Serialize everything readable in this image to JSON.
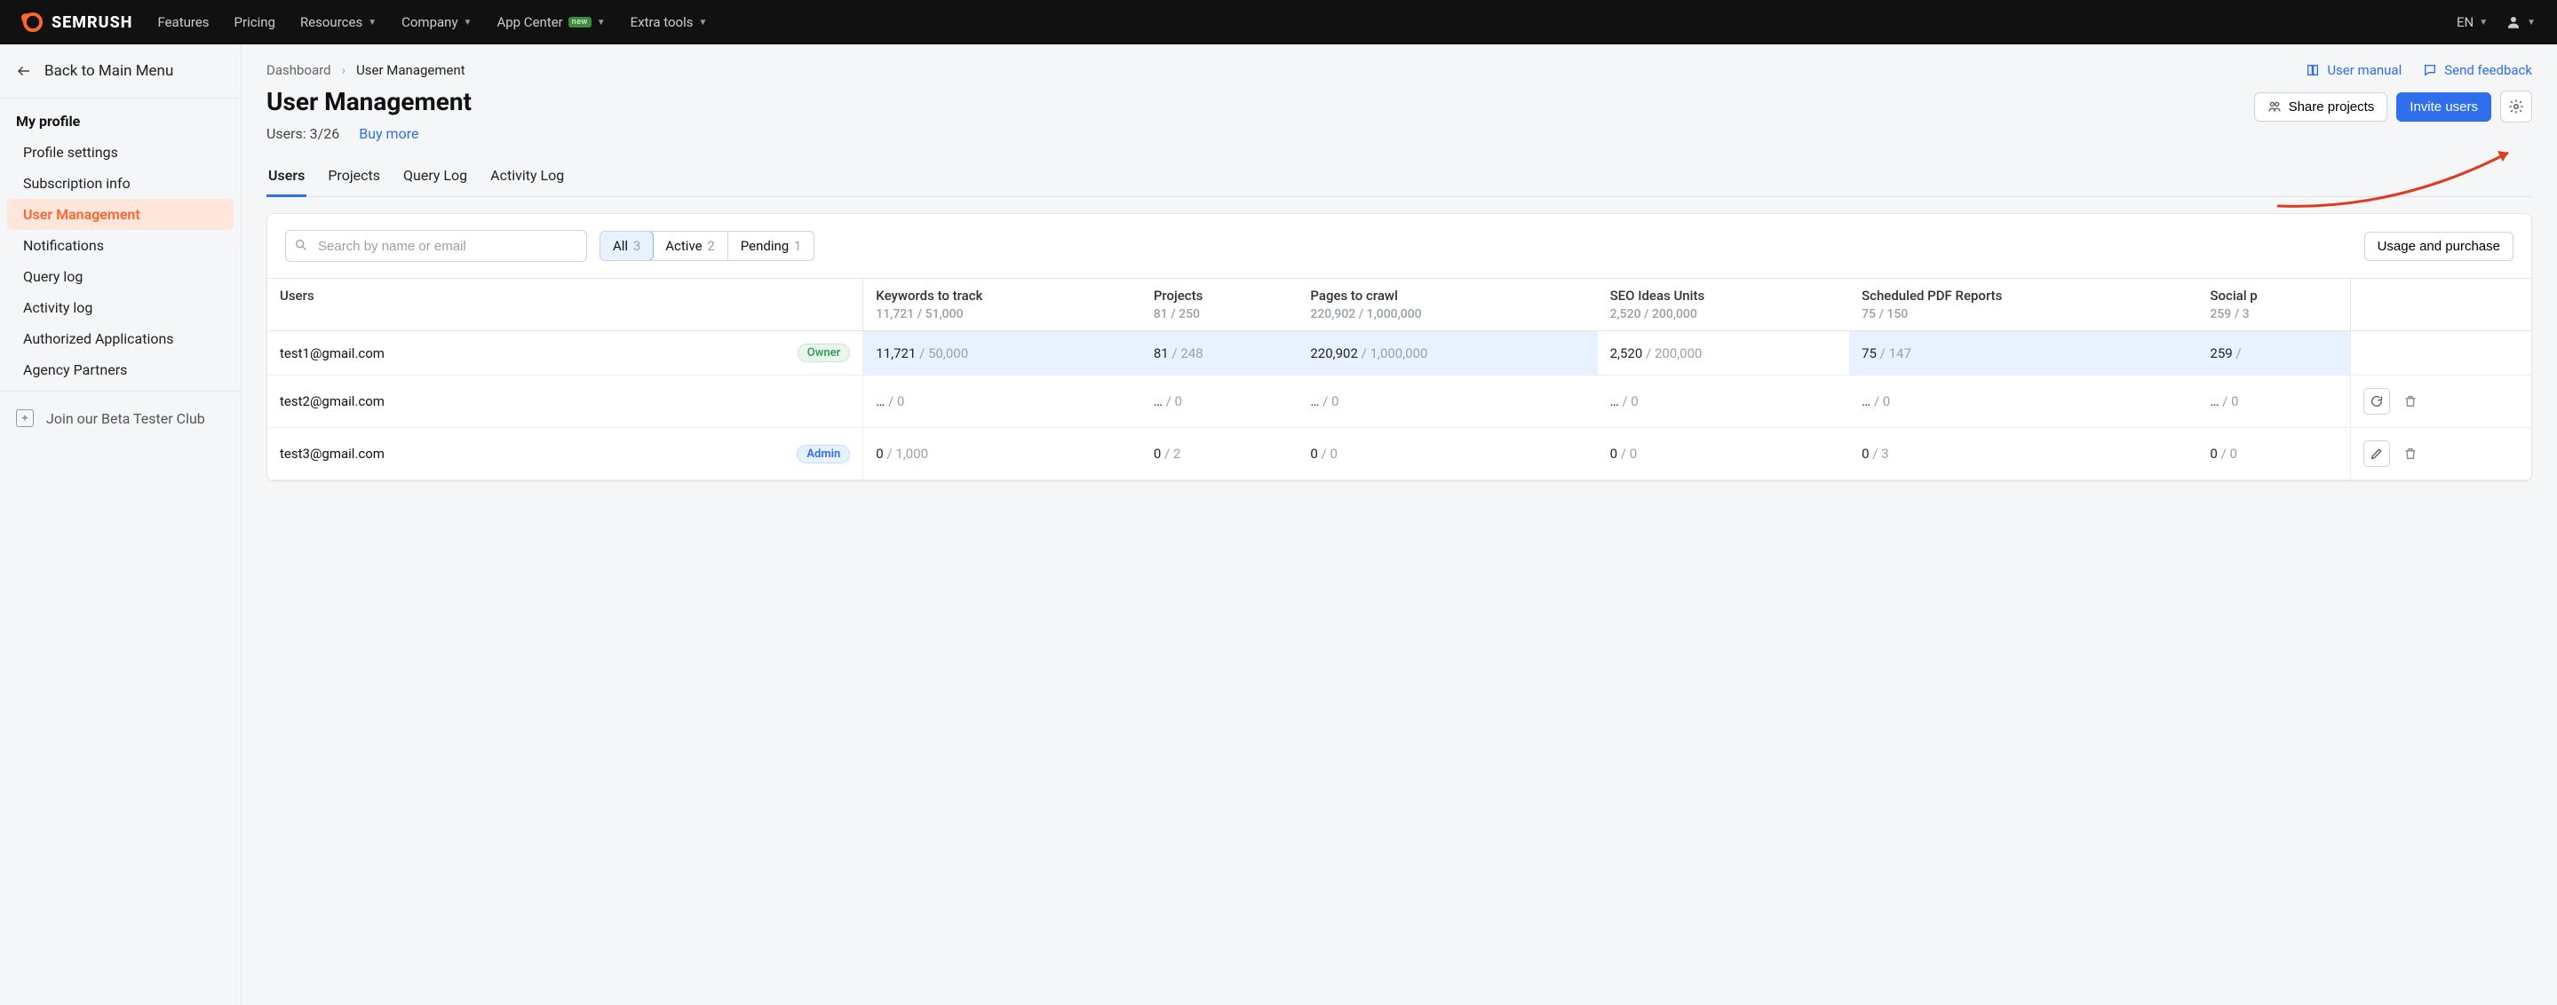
{
  "brand": "SEMRUSH",
  "nav": {
    "features": "Features",
    "pricing": "Pricing",
    "resources": "Resources",
    "company": "Company",
    "appcenter": "App Center",
    "appcenter_badge": "new",
    "extratools": "Extra tools",
    "lang": "EN"
  },
  "sidebar": {
    "back": "Back to Main Menu",
    "heading": "My profile",
    "items": {
      "profile_settings": "Profile settings",
      "subscription_info": "Subscription info",
      "user_management": "User Management",
      "notifications": "Notifications",
      "query_log": "Query log",
      "activity_log": "Activity log",
      "authorized_applications": "Authorized Applications",
      "agency_partners": "Agency Partners"
    },
    "beta": "Join our Beta Tester Club"
  },
  "breadcrumb": {
    "dashboard": "Dashboard",
    "current": "User Management"
  },
  "top_links": {
    "manual": "User manual",
    "feedback": "Send feedback"
  },
  "page": {
    "title": "User Management",
    "users_count": "Users: 3/26",
    "buy_more": "Buy more"
  },
  "header_buttons": {
    "share": "Share projects",
    "invite": "Invite users"
  },
  "tabs": {
    "users": "Users",
    "projects": "Projects",
    "query_log": "Query Log",
    "activity_log": "Activity Log"
  },
  "search": {
    "placeholder": "Search by name or email"
  },
  "filters": {
    "all_label": "All",
    "all_count": "3",
    "active_label": "Active",
    "active_count": "2",
    "pending_label": "Pending",
    "pending_count": "1"
  },
  "toolbar": {
    "usage": "Usage and purchase"
  },
  "table": {
    "columns": {
      "users": {
        "label": "Users"
      },
      "keywords": {
        "label": "Keywords to track",
        "sub": "11,721 / 51,000"
      },
      "projects": {
        "label": "Projects",
        "sub": "81 / 250"
      },
      "pages": {
        "label": "Pages to crawl",
        "sub": "220,902 / 1,000,000"
      },
      "seo": {
        "label": "SEO Ideas Units",
        "sub": "2,520 / 200,000"
      },
      "pdf": {
        "label": "Scheduled PDF Reports",
        "sub": "75 / 150"
      },
      "social": {
        "label": "Social p",
        "sub": "259 / 3"
      }
    },
    "rows": [
      {
        "email": "test1@gmail.com",
        "role": "Owner",
        "keywords": {
          "a": "11,721",
          "b": "50,000"
        },
        "projects": {
          "a": "81",
          "b": "248"
        },
        "pages": {
          "a": "220,902",
          "b": "1,000,000"
        },
        "seo": {
          "a": "2,520",
          "b": "200,000"
        },
        "pdf": {
          "a": "75",
          "b": "147"
        },
        "social": {
          "a": "259",
          "b": ""
        }
      },
      {
        "email": "test2@gmail.com",
        "role": "",
        "keywords": {
          "a": "…",
          "b": "0"
        },
        "projects": {
          "a": "…",
          "b": "0"
        },
        "pages": {
          "a": "…",
          "b": "0"
        },
        "seo": {
          "a": "…",
          "b": "0"
        },
        "pdf": {
          "a": "…",
          "b": "0"
        },
        "social": {
          "a": "…",
          "b": "0"
        }
      },
      {
        "email": "test3@gmail.com",
        "role": "Admin",
        "keywords": {
          "a": "0",
          "b": "1,000"
        },
        "projects": {
          "a": "0",
          "b": "2"
        },
        "pages": {
          "a": "0",
          "b": "0"
        },
        "seo": {
          "a": "0",
          "b": "0"
        },
        "pdf": {
          "a": "0",
          "b": "3"
        },
        "social": {
          "a": "0",
          "b": "0"
        }
      }
    ]
  }
}
